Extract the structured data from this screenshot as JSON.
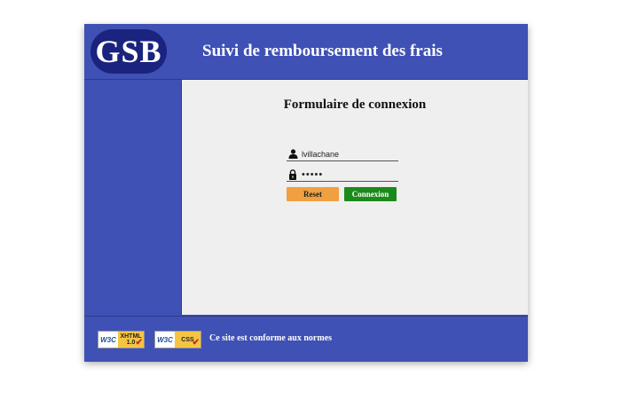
{
  "header": {
    "logo_text": "GSB",
    "title": "Suivi de remboursement des frais"
  },
  "login_form": {
    "title": "Formulaire de connexion",
    "login_value": "lvillachane",
    "login_icon": "user-icon",
    "password_masked": "•••••",
    "password_icon": "lock-icon",
    "reset_label": "Reset",
    "connect_label": "Connexion"
  },
  "footer": {
    "badge_xhtml": {
      "w3c": "W3C",
      "label": "XHTML",
      "version": "1.0"
    },
    "badge_css": {
      "w3c": "W3C",
      "label": "CSS"
    },
    "note": "Ce site est conforme aux normes"
  },
  "colors": {
    "primary": "#3f51b5",
    "logo_bg": "#1a237e",
    "reset": "#f0a040",
    "connect": "#1b8a1b",
    "content_bg": "#efefef"
  }
}
